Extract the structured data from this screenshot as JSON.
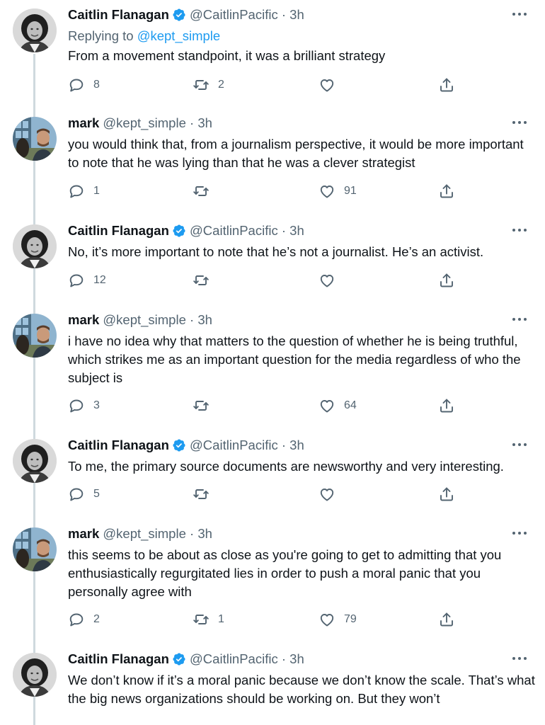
{
  "colors": {
    "accent": "#1d9bf0",
    "text": "#0f1419",
    "muted": "#536471",
    "thread_line": "#cfd9de"
  },
  "thread": [
    {
      "author": "Caitlin Flanagan",
      "verified": true,
      "handle": "@CaitlinPacific",
      "time": "· 3h",
      "replying_prefix": "Replying to",
      "replying_to": "@kept_simple",
      "text": "From a movement standpoint, it was a brilliant strategy",
      "replies": "8",
      "retweets": "2",
      "likes": ""
    },
    {
      "author": "mark",
      "verified": false,
      "handle": "@kept_simple",
      "time": "· 3h",
      "text": "you would think that, from a journalism perspective, it would be more important to note that he was lying than that he was a clever strategist",
      "replies": "1",
      "retweets": "",
      "likes": "91"
    },
    {
      "author": "Caitlin Flanagan",
      "verified": true,
      "handle": "@CaitlinPacific",
      "time": "· 3h",
      "text": "No, it’s more important to note that he’s not a journalist. He’s an activist.",
      "replies": "12",
      "retweets": "",
      "likes": ""
    },
    {
      "author": "mark",
      "verified": false,
      "handle": "@kept_simple",
      "time": "· 3h",
      "text": "i have no idea why that matters to the question of whether he is being truthful, which strikes me as an important question for the media regardless of who the subject is",
      "replies": "3",
      "retweets": "",
      "likes": "64"
    },
    {
      "author": "Caitlin Flanagan",
      "verified": true,
      "handle": "@CaitlinPacific",
      "time": "· 3h",
      "text": "To me, the primary source documents are newsworthy and very interesting.",
      "replies": "5",
      "retweets": "",
      "likes": ""
    },
    {
      "author": "mark",
      "verified": false,
      "handle": "@kept_simple",
      "time": "· 3h",
      "text": "this seems to be about as close as you're going to get to admitting that you enthusiastically regurgitated lies in order to push a moral panic that you personally agree with",
      "replies": "2",
      "retweets": "1",
      "likes": "79"
    },
    {
      "author": "Caitlin Flanagan",
      "verified": true,
      "handle": "@CaitlinPacific",
      "time": "· 3h",
      "text": "We don’t know if it’s a moral panic because we don’t know the scale. That’s what the big news organizations should be working on. But they won’t",
      "replies": "",
      "retweets": "",
      "likes": ""
    }
  ]
}
